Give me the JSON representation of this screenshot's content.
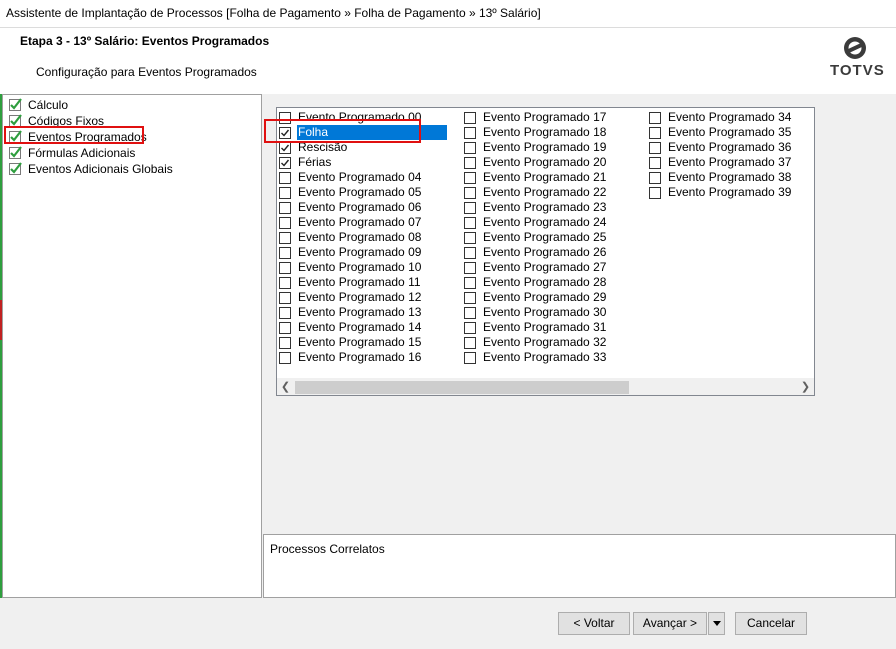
{
  "window": {
    "title": "Assistente de Implantação de Processos [Folha de Pagamento » Folha de Pagamento » 13º Salário]"
  },
  "header": {
    "step_title": "Etapa 3 - 13º Salário: Eventos Programados",
    "subtitle": "Configuração para Eventos Programados",
    "logo_text": "TOTVS"
  },
  "tree": {
    "items": [
      {
        "label": "Cálculo",
        "icon": "green-check-icon"
      },
      {
        "label": "Códigos Fixos",
        "icon": "green-check-icon"
      },
      {
        "label": "Eventos Programados",
        "icon": "green-check-icon",
        "highlighted": true
      },
      {
        "label": "Fórmulas Adicionais",
        "icon": "green-check-icon"
      },
      {
        "label": "Eventos Adicionais Globais",
        "icon": "green-check-icon"
      }
    ]
  },
  "events": {
    "columns": [
      [
        {
          "label": "Evento Programado 00",
          "checked": false
        },
        {
          "label": "Folha",
          "checked": true,
          "selected": true
        },
        {
          "label": "Rescisão",
          "checked": true
        },
        {
          "label": "Férias",
          "checked": true
        },
        {
          "label": "Evento Programado 04",
          "checked": false
        },
        {
          "label": "Evento Programado 05",
          "checked": false
        },
        {
          "label": "Evento Programado 06",
          "checked": false
        },
        {
          "label": "Evento Programado 07",
          "checked": false
        },
        {
          "label": "Evento Programado 08",
          "checked": false
        },
        {
          "label": "Evento Programado 09",
          "checked": false
        },
        {
          "label": "Evento Programado 10",
          "checked": false
        },
        {
          "label": "Evento Programado 11",
          "checked": false
        },
        {
          "label": "Evento Programado 12",
          "checked": false
        },
        {
          "label": "Evento Programado 13",
          "checked": false
        },
        {
          "label": "Evento Programado 14",
          "checked": false
        },
        {
          "label": "Evento Programado 15",
          "checked": false
        },
        {
          "label": "Evento Programado 16",
          "checked": false
        }
      ],
      [
        {
          "label": "Evento Programado 17",
          "checked": false
        },
        {
          "label": "Evento Programado 18",
          "checked": false
        },
        {
          "label": "Evento Programado 19",
          "checked": false
        },
        {
          "label": "Evento Programado 20",
          "checked": false
        },
        {
          "label": "Evento Programado 21",
          "checked": false
        },
        {
          "label": "Evento Programado 22",
          "checked": false
        },
        {
          "label": "Evento Programado 23",
          "checked": false
        },
        {
          "label": "Evento Programado 24",
          "checked": false
        },
        {
          "label": "Evento Programado 25",
          "checked": false
        },
        {
          "label": "Evento Programado 26",
          "checked": false
        },
        {
          "label": "Evento Programado 27",
          "checked": false
        },
        {
          "label": "Evento Programado 28",
          "checked": false
        },
        {
          "label": "Evento Programado 29",
          "checked": false
        },
        {
          "label": "Evento Programado 30",
          "checked": false
        },
        {
          "label": "Evento Programado 31",
          "checked": false
        },
        {
          "label": "Evento Programado 32",
          "checked": false
        },
        {
          "label": "Evento Programado 33",
          "checked": false
        }
      ],
      [
        {
          "label": "Evento Programado 34",
          "checked": false
        },
        {
          "label": "Evento Programado 35",
          "checked": false
        },
        {
          "label": "Evento Programado 36",
          "checked": false
        },
        {
          "label": "Evento Programado 37",
          "checked": false
        },
        {
          "label": "Evento Programado 38",
          "checked": false
        },
        {
          "label": "Evento Programado 39",
          "checked": false
        }
      ]
    ]
  },
  "related": {
    "label": "Processos Correlatos"
  },
  "buttons": {
    "back": "< Voltar",
    "next": "Avançar >",
    "cancel": "Cancelar"
  },
  "colors": {
    "selection": "#0078d7",
    "highlight_box": "#e01010",
    "tree_check": "#2e9e3e"
  }
}
